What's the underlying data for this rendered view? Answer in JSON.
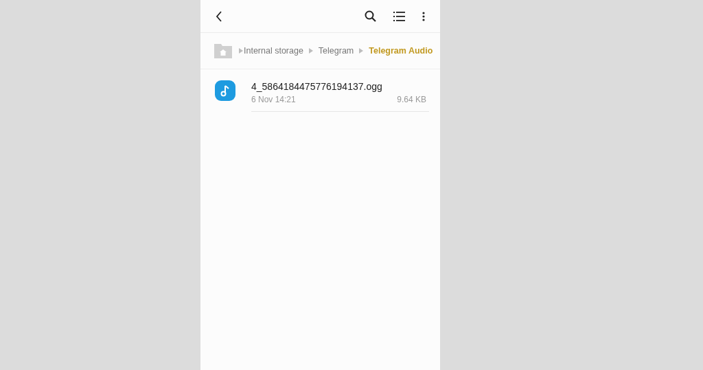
{
  "breadcrumbs": [
    {
      "label": "Internal storage",
      "selected": false
    },
    {
      "label": "Telegram",
      "selected": false
    },
    {
      "label": "Telegram Audio",
      "selected": true
    }
  ],
  "files": [
    {
      "name": "4_5864184475776194137.ogg",
      "date": "6 Nov 14:21",
      "size": "9.64 KB"
    }
  ]
}
